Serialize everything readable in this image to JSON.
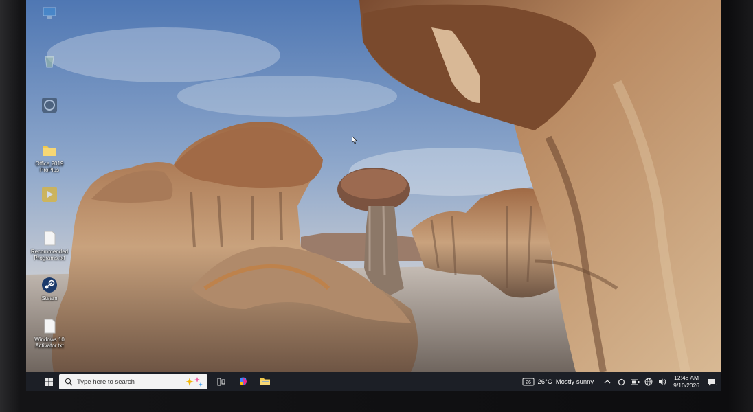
{
  "desktop": {
    "icons": [
      {
        "label": "",
        "icon": "monitor-icon"
      },
      {
        "label": "",
        "icon": "recycle-bin-icon"
      },
      {
        "label": "",
        "icon": "app-icon"
      },
      {
        "label": "Office 2019 ProPlus",
        "icon": "folder-icon"
      },
      {
        "label": "",
        "icon": "media-player-icon"
      },
      {
        "label": "Recommended Programs.txt",
        "icon": "text-file-icon"
      },
      {
        "label": "Steam",
        "icon": "steam-icon"
      },
      {
        "label": "Windows 10 Activator.txt",
        "icon": "text-file-icon"
      }
    ]
  },
  "taskbar": {
    "search_placeholder": "Type here to search",
    "apps": [
      {
        "name": "task-view",
        "icon": "task-view-icon"
      },
      {
        "name": "copilot",
        "icon": "copilot-icon"
      },
      {
        "name": "file-explorer",
        "icon": "folder-icon"
      }
    ],
    "weather": {
      "temperature": "26°C",
      "condition": "Mostly sunny"
    },
    "clock": {
      "time": "12:48 AM",
      "date": "9/10/2026"
    },
    "notification_count": "1"
  },
  "colors": {
    "taskbar": "#1c1f26",
    "search_bg": "#f3f3f3",
    "sky": "#6f8fb8",
    "rock": "#b08866"
  }
}
